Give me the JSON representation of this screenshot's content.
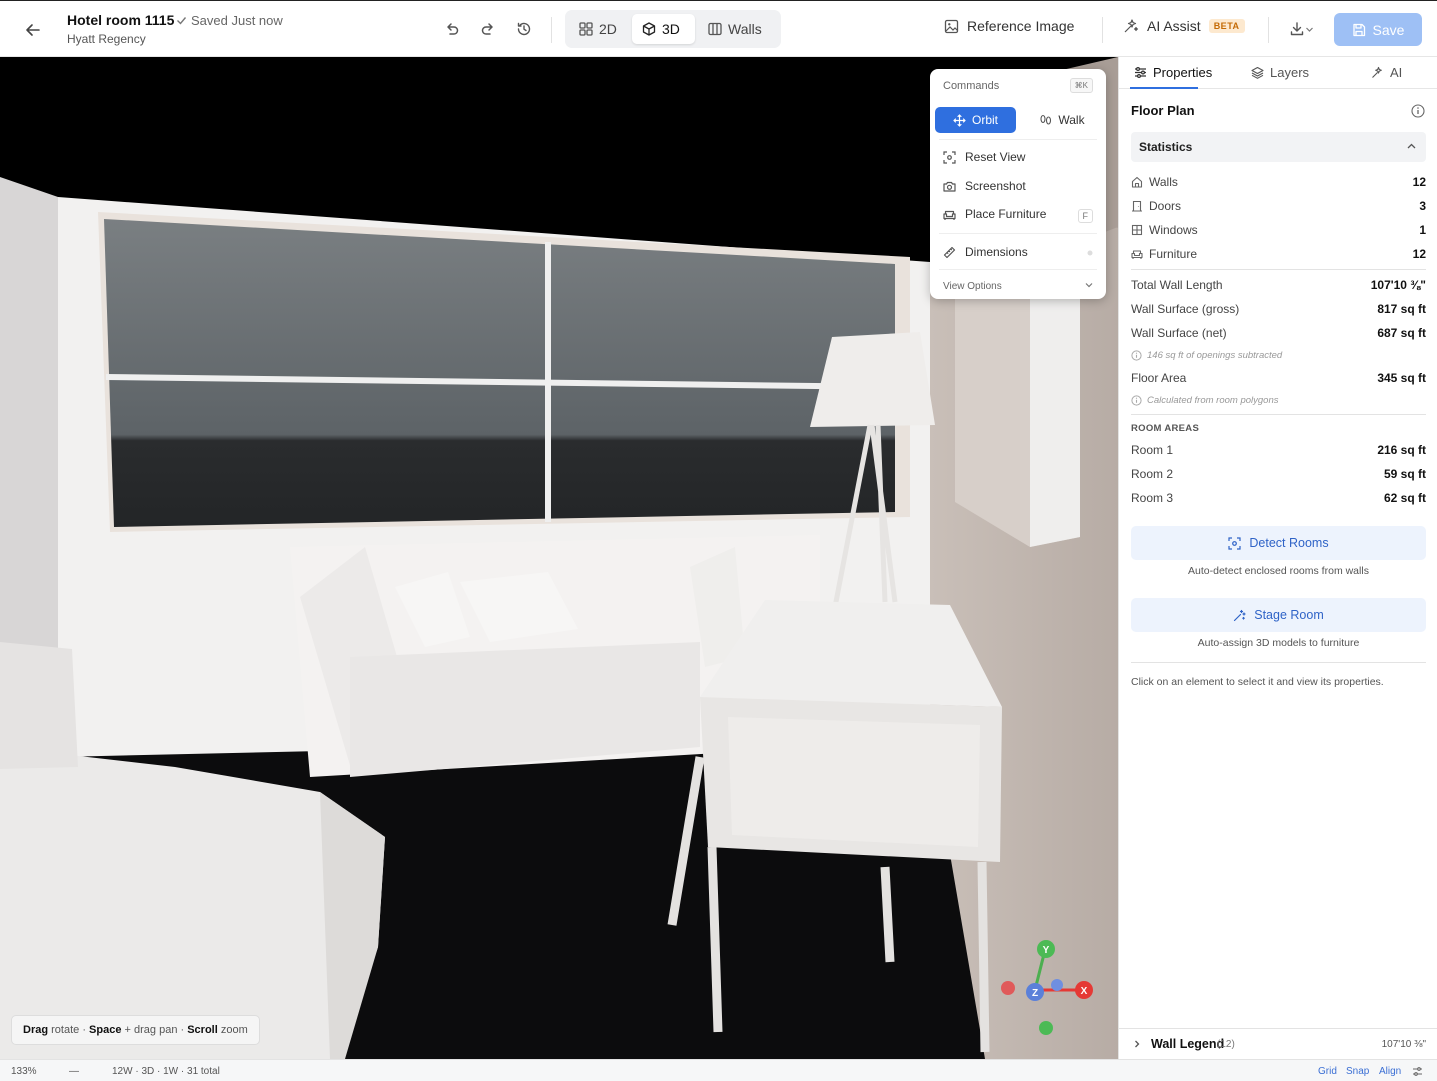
{
  "header": {
    "title": "Hotel room 1115",
    "saved_status": "Saved Just now",
    "subtitle": "Hyatt Regency",
    "view_modes": [
      {
        "label": "2D",
        "active": false
      },
      {
        "label": "3D",
        "active": true
      },
      {
        "label": "Walls",
        "active": false
      }
    ],
    "reference_image": "Reference Image",
    "ai_assist": "AI Assist",
    "ai_badge": "BETA",
    "save_label": "Save",
    "accent_color": "#2f6fdf"
  },
  "commands": {
    "title": "Commands",
    "shortcut": "⌘K",
    "modes": [
      {
        "label": "Orbit",
        "active": true
      },
      {
        "label": "Walk",
        "active": false
      }
    ],
    "items": [
      {
        "label": "Reset View",
        "icon": "focus-icon"
      },
      {
        "label": "Screenshot",
        "icon": "camera-icon"
      },
      {
        "label": "Place Furniture",
        "icon": "sofa-icon",
        "shortcut": "F"
      },
      {
        "label": "Dimensions",
        "icon": "ruler-icon"
      }
    ],
    "view_options": "View Options"
  },
  "viewport": {
    "hint": {
      "drag": "Drag",
      "drag_action": "rotate",
      "space": "Space",
      "space_action": "+ drag pan",
      "scroll": "Scroll",
      "scroll_action": "zoom"
    },
    "axes": {
      "y": "Y",
      "x": "X",
      "z": "Z"
    }
  },
  "panel": {
    "tabs": [
      {
        "label": "Properties",
        "icon": "sliders-icon",
        "active": true
      },
      {
        "label": "Layers",
        "icon": "layers-icon",
        "active": false
      },
      {
        "label": "AI",
        "icon": "sparkle-icon",
        "active": false
      }
    ],
    "title": "Floor Plan",
    "statistics_label": "Statistics",
    "counts": [
      {
        "label": "Walls",
        "value": "12",
        "icon": "house-icon"
      },
      {
        "label": "Doors",
        "value": "3",
        "icon": "door-icon"
      },
      {
        "label": "Windows",
        "value": "1",
        "icon": "window-icon"
      },
      {
        "label": "Furniture",
        "value": "12",
        "icon": "sofa-icon"
      }
    ],
    "measures": [
      {
        "label": "Total Wall Length",
        "value": "107'10 ⅜\""
      },
      {
        "label": "Wall Surface (gross)",
        "value": "817 sq ft"
      },
      {
        "label": "Wall Surface (net)",
        "value": "687 sq ft"
      }
    ],
    "openings_note": "146 sq ft of openings subtracted",
    "floor_area": {
      "label": "Floor Area",
      "value": "345 sq ft"
    },
    "floor_note": "Calculated from room polygons",
    "room_areas_label": "ROOM AREAS",
    "rooms": [
      {
        "label": "Room 1",
        "value": "216 sq ft"
      },
      {
        "label": "Room 2",
        "value": "59 sq ft"
      },
      {
        "label": "Room 3",
        "value": "62 sq ft"
      }
    ],
    "detect_rooms": "Detect Rooms",
    "detect_caption": "Auto-detect enclosed rooms from walls",
    "stage_room": "Stage Room",
    "stage_caption": "Auto-assign 3D models to furniture",
    "help_text": "Click on an element to select it and view its properties.",
    "legend": {
      "label": "Wall Legend",
      "count": "(12)",
      "value": "107'10 ⅜\""
    }
  },
  "status_bar": {
    "zoom": "133%",
    "dash": "—",
    "summary": "12W · 3D · 1W · 31 total",
    "grid": "Grid",
    "snap": "Snap",
    "align": "Align"
  }
}
